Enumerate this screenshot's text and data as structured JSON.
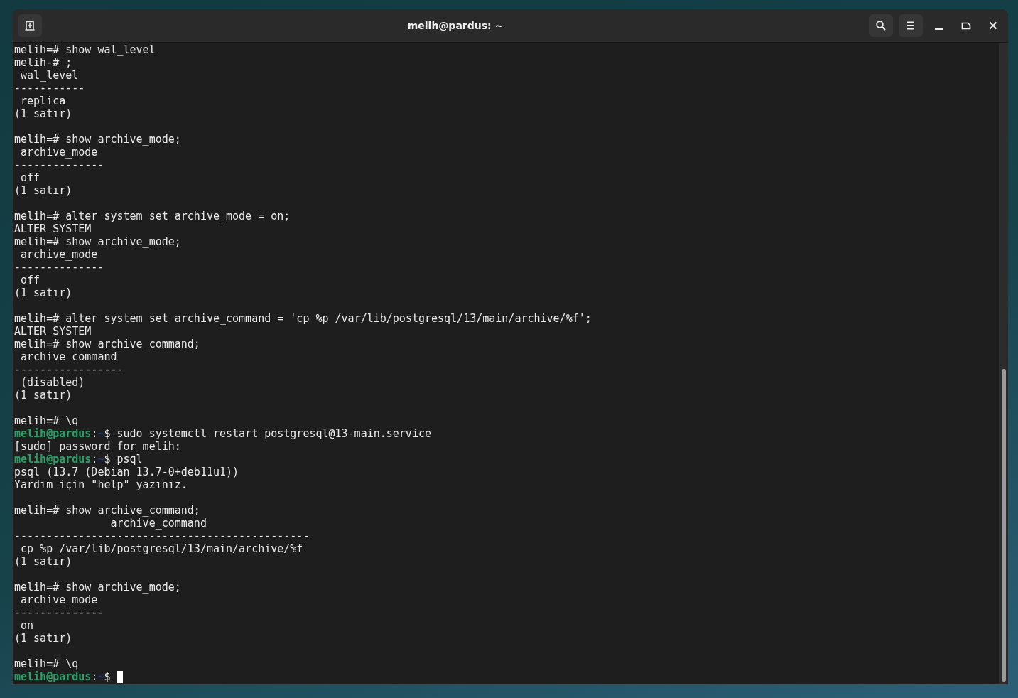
{
  "window": {
    "title": "melih@pardus: ~"
  },
  "terminal": {
    "lines": [
      {
        "kind": "output",
        "text": "melih=# show wal_level"
      },
      {
        "kind": "output",
        "text": "melih-# ;"
      },
      {
        "kind": "output",
        "text": " wal_level"
      },
      {
        "kind": "output",
        "text": "-----------"
      },
      {
        "kind": "output",
        "text": " replica"
      },
      {
        "kind": "output",
        "text": "(1 satır)"
      },
      {
        "kind": "blank"
      },
      {
        "kind": "output",
        "text": "melih=# show archive_mode;"
      },
      {
        "kind": "output",
        "text": " archive_mode"
      },
      {
        "kind": "output",
        "text": "--------------"
      },
      {
        "kind": "output",
        "text": " off"
      },
      {
        "kind": "output",
        "text": "(1 satır)"
      },
      {
        "kind": "blank"
      },
      {
        "kind": "output",
        "text": "melih=# alter system set archive_mode = on;"
      },
      {
        "kind": "output",
        "text": "ALTER SYSTEM"
      },
      {
        "kind": "output",
        "text": "melih=# show archive_mode;"
      },
      {
        "kind": "output",
        "text": " archive_mode"
      },
      {
        "kind": "output",
        "text": "--------------"
      },
      {
        "kind": "output",
        "text": " off"
      },
      {
        "kind": "output",
        "text": "(1 satır)"
      },
      {
        "kind": "blank"
      },
      {
        "kind": "output",
        "text": "melih=# alter system set archive_command = 'cp %p /var/lib/postgresql/13/main/archive/%f';"
      },
      {
        "kind": "output",
        "text": "ALTER SYSTEM"
      },
      {
        "kind": "output",
        "text": "melih=# show archive_command;"
      },
      {
        "kind": "output",
        "text": " archive_command"
      },
      {
        "kind": "output",
        "text": "-----------------"
      },
      {
        "kind": "output",
        "text": " (disabled)"
      },
      {
        "kind": "output",
        "text": "(1 satır)"
      },
      {
        "kind": "blank"
      },
      {
        "kind": "output",
        "text": "melih=# \\q"
      },
      {
        "kind": "prompt",
        "user_host": "melih@pardus",
        "separator": ":",
        "path": "~",
        "sign": "$",
        "command": "sudo systemctl restart postgresql@13-main.service",
        "cursor": false
      },
      {
        "kind": "output",
        "text": "[sudo] password for melih:"
      },
      {
        "kind": "prompt",
        "user_host": "melih@pardus",
        "separator": ":",
        "path": "~",
        "sign": "$",
        "command": "psql",
        "cursor": false
      },
      {
        "kind": "output",
        "text": "psql (13.7 (Debian 13.7-0+deb11u1))"
      },
      {
        "kind": "output",
        "text": "Yardım için \"help\" yazınız."
      },
      {
        "kind": "blank"
      },
      {
        "kind": "output",
        "text": "melih=# show archive_command;"
      },
      {
        "kind": "output",
        "text": "               archive_command"
      },
      {
        "kind": "output",
        "text": "----------------------------------------------"
      },
      {
        "kind": "output",
        "text": " cp %p /var/lib/postgresql/13/main/archive/%f"
      },
      {
        "kind": "output",
        "text": "(1 satır)"
      },
      {
        "kind": "blank"
      },
      {
        "kind": "output",
        "text": "melih=# show archive_mode;"
      },
      {
        "kind": "output",
        "text": " archive_mode"
      },
      {
        "kind": "output",
        "text": "--------------"
      },
      {
        "kind": "output",
        "text": " on"
      },
      {
        "kind": "output",
        "text": "(1 satır)"
      },
      {
        "kind": "blank"
      },
      {
        "kind": "output",
        "text": "melih=# \\q"
      },
      {
        "kind": "prompt",
        "user_host": "melih@pardus",
        "separator": ":",
        "path": "~",
        "sign": "$",
        "cursor": true
      }
    ]
  }
}
